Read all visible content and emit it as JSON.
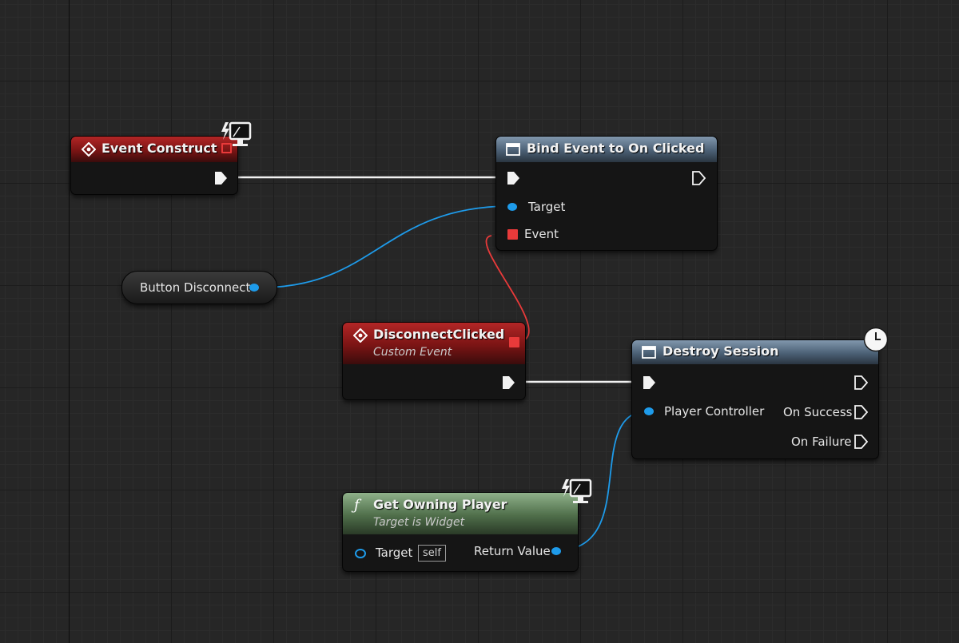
{
  "graph": {
    "nodes": {
      "event_construct": {
        "title": "Event Construct",
        "icon": "event-diamond-icon",
        "badge": "client-only-monitor-icon"
      },
      "bind_event": {
        "title": "Bind Event to On Clicked",
        "icon": "function-window-icon",
        "pins": {
          "target": "Target",
          "event": "Event"
        }
      },
      "button_disconnect": {
        "label": "Button Disconnect"
      },
      "disconnect_clicked": {
        "title": "DisconnectClicked",
        "subtitle": "Custom Event",
        "icon": "event-diamond-icon"
      },
      "destroy_session": {
        "title": "Destroy Session",
        "icon": "function-window-icon",
        "badge": "latent-clock-icon",
        "pins": {
          "player_controller": "Player Controller",
          "on_success": "On Success",
          "on_failure": "On Failure"
        }
      },
      "get_owning_player": {
        "title": "Get Owning Player",
        "subtitle": "Target is Widget",
        "icon": "function-f-icon",
        "badge": "client-only-monitor-icon",
        "pins": {
          "target": "Target",
          "target_default": "self",
          "return_value": "Return Value"
        }
      }
    }
  },
  "colors": {
    "exec_wire": "#ffffff",
    "object_wire": "#1e9bea",
    "delegate_wire": "#e83a3a",
    "event_header": "#a11f1f",
    "function_header": "#5e7488",
    "pure_header": "#5f7d5a"
  }
}
